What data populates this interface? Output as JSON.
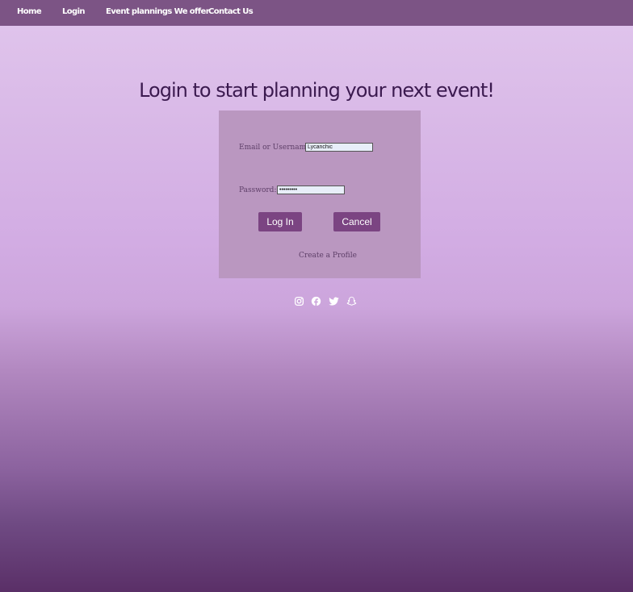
{
  "nav": {
    "items": [
      {
        "label": "Home"
      },
      {
        "label": "Login"
      },
      {
        "label": "Event plannings We offer"
      },
      {
        "label": "Contact Us"
      }
    ]
  },
  "main": {
    "title": "Login to start planning your next event!"
  },
  "login_form": {
    "email_label": "Email or Username:",
    "email_value": "Lycanchic",
    "password_label": "Password:",
    "password_value": "•••••••••",
    "login_button": "Log In",
    "cancel_button": "Cancel",
    "create_profile_link": "Create a Profile"
  },
  "social": {
    "icons": [
      "instagram-icon",
      "facebook-icon",
      "twitter-icon",
      "snapchat-icon"
    ]
  },
  "colors": {
    "nav_background": "#7c5485",
    "panel_background": "#ba97c0",
    "button_background": "#7b4482",
    "title_text": "#3b1a4f"
  }
}
